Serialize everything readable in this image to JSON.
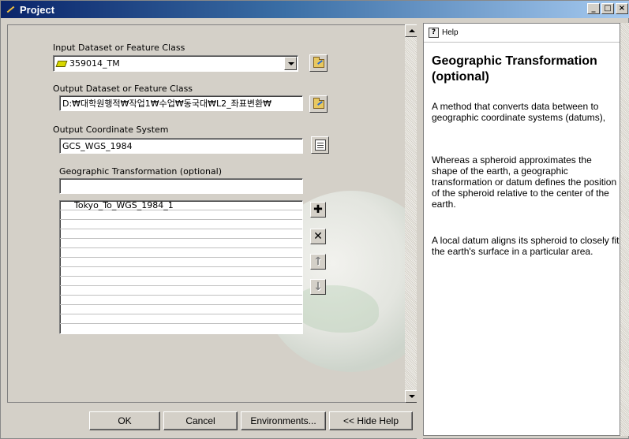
{
  "window": {
    "title": "Project",
    "min_label": "_",
    "max_label": "□",
    "close_label": "×"
  },
  "form": {
    "input_label": "Input Dataset or Feature Class",
    "input_value": "359014_TM",
    "output_label": "Output Dataset or Feature Class",
    "output_value": "D:₩대학원행적₩작업1₩수업₩동국대₩L2_좌표변환₩",
    "coord_label": "Output Coordinate System",
    "coord_value": "GCS_WGS_1984",
    "transform_label": "Geographic Transformation (optional)",
    "transform_value": "",
    "list_items": [
      "Tokyo_To_WGS_1984_1",
      "",
      "",
      "",
      "",
      "",
      "",
      "",
      "",
      "",
      "",
      "",
      "",
      "",
      ""
    ],
    "add_glyph": "✚",
    "remove_glyph": "✕",
    "up_glyph": "↑",
    "down_glyph": "↓"
  },
  "buttons": {
    "ok": "OK",
    "cancel": "Cancel",
    "environments": "Environments...",
    "hide_help": "<< Hide Help"
  },
  "help": {
    "tab_label": "Help",
    "icon_glyph": "?",
    "title": "Geographic Transformation (optional)",
    "para1": "A method that converts data between to geographic coordinate systems (datums),",
    "para2": "Whereas a spheroid approximates the shape of the earth, a geographic transformation or datum defines the position of the spheroid relative to the center of the earth.",
    "para3": "A local datum aligns its spheroid to closely fit the earth's surface in a particular area."
  }
}
